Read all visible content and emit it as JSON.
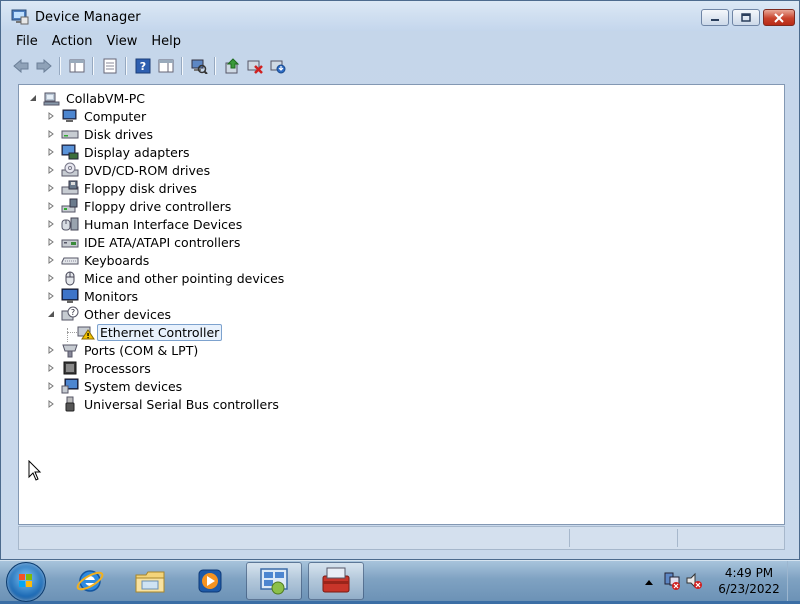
{
  "window": {
    "title": "Device Manager",
    "icon": "device-manager-icon"
  },
  "menu": [
    "File",
    "Action",
    "View",
    "Help"
  ],
  "toolbar": {
    "buttons": [
      "back-arrow-icon",
      "forward-arrow-icon",
      "show-hide-console-tree-icon",
      "properties-icon",
      "help-icon",
      "show-hide-action-pane-icon",
      "scan-hardware-changes-icon",
      "update-driver-icon",
      "disable-device-icon",
      "uninstall-device-icon"
    ]
  },
  "tree": {
    "root": "CollabVM-PC",
    "categories": [
      {
        "label": "Computer",
        "expanded": false
      },
      {
        "label": "Disk drives",
        "expanded": false
      },
      {
        "label": "Display adapters",
        "expanded": false
      },
      {
        "label": "DVD/CD-ROM drives",
        "expanded": false
      },
      {
        "label": "Floppy disk drives",
        "expanded": false
      },
      {
        "label": "Floppy drive controllers",
        "expanded": false
      },
      {
        "label": "Human Interface Devices",
        "expanded": false
      },
      {
        "label": "IDE ATA/ATAPI controllers",
        "expanded": false
      },
      {
        "label": "Keyboards",
        "expanded": false
      },
      {
        "label": "Mice and other pointing devices",
        "expanded": false
      },
      {
        "label": "Monitors",
        "expanded": false
      },
      {
        "label": "Other devices",
        "expanded": true
      },
      {
        "label": "Ports (COM & LPT)",
        "expanded": false
      },
      {
        "label": "Processors",
        "expanded": false
      },
      {
        "label": "System devices",
        "expanded": false
      },
      {
        "label": "Universal Serial Bus controllers",
        "expanded": false
      }
    ],
    "other_devices_children": [
      {
        "label": "Ethernet Controller",
        "selected": true,
        "warning": true
      }
    ]
  },
  "taskbar": {
    "pinned": [
      "internet-explorer-icon",
      "windows-explorer-icon",
      "media-player-icon",
      "control-panel-icon",
      "device-manager-toolbox-icon"
    ],
    "active_task": "device-manager-toolbox-icon",
    "clock_time": "4:49 PM",
    "clock_date": "6/23/2022"
  },
  "colors": {
    "accent": "#1f6cb6",
    "selection_border": "#7da2ce",
    "warning_yellow": "#f2c200"
  }
}
